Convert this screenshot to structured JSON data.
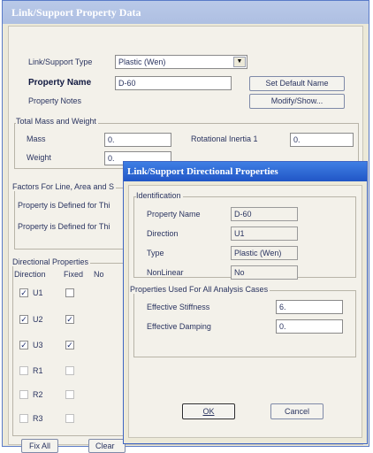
{
  "main_dialog": {
    "title": "Link/Support Property Data",
    "link_support_type_label": "Link/Support Type",
    "link_support_type_value": "Plastic (Wen)",
    "property_name_label": "Property Name",
    "property_name_value": "D-60",
    "set_default_name_button": "Set Default Name",
    "property_notes_label": "Property Notes",
    "modify_show_button": "Modify/Show...",
    "mass_weight_group": "Total Mass and Weight",
    "mass_label": "Mass",
    "mass_value": "0.",
    "weight_label": "Weight",
    "weight_value": "0.",
    "rot_inertia_label": "Rotational Inertia 1",
    "rot_inertia_value": "0.",
    "factors_group": "Factors For Line, Area and S",
    "property_defined_1": "Property is Defined for Thi",
    "property_defined_2": "Property is Defined for Thi",
    "directional_group": "Directional Properties",
    "direction_header": "Direction",
    "fixed_header": "Fixed",
    "nonlinear_header": "No",
    "directions": [
      {
        "label": "U1",
        "direction_checked": true,
        "fixed_checked": false
      },
      {
        "label": "U2",
        "direction_checked": true,
        "fixed_checked": true
      },
      {
        "label": "U3",
        "direction_checked": true,
        "fixed_checked": true
      },
      {
        "label": "R1",
        "direction_checked": false,
        "fixed_checked": false
      },
      {
        "label": "R2",
        "direction_checked": false,
        "fixed_checked": false
      },
      {
        "label": "R3",
        "direction_checked": false,
        "fixed_checked": false
      }
    ],
    "fix_all_button": "Fix All",
    "clear_all_button": "Clear"
  },
  "sub_dialog": {
    "title": "Link/Support Directional Properties",
    "identification_group": "Identification",
    "property_name_label": "Property Name",
    "property_name_value": "D-60",
    "direction_label": "Direction",
    "direction_value": "U1",
    "type_label": "Type",
    "type_value": "Plastic (Wen)",
    "nonlinear_label": "NonLinear",
    "nonlinear_value": "No",
    "analysis_group": "Properties Used For All Analysis Cases",
    "effective_stiffness_label": "Effective Stiffness",
    "effective_stiffness_value": "6.",
    "effective_damping_label": "Effective Damping",
    "effective_damping_value": "0.",
    "ok_button": "OK",
    "cancel_button": "Cancel"
  },
  "colors": {
    "inactive_titlebar": "#b9c9e8",
    "active_titlebar": "#2156c6",
    "dialog_face": "#ece9d8"
  }
}
